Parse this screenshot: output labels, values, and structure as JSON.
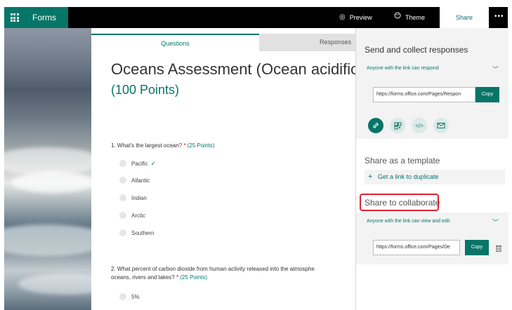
{
  "topbar": {
    "app_name": "Forms",
    "preview_label": "Preview",
    "theme_label": "Theme",
    "share_label": "Share",
    "more_label": "•••"
  },
  "tabs": {
    "questions": "Questions",
    "responses": "Responses"
  },
  "form": {
    "title": "Oceans Assessment (Ocean acidificatio",
    "points": "(100 Points)",
    "questions": [
      {
        "text": "1. What's the largest ocean?",
        "required": "*",
        "points": "(25 Points)",
        "options": [
          "Pacific",
          "Atlantic",
          "Indian",
          "Arctic",
          "Southern"
        ],
        "correct_mark": "✓"
      },
      {
        "text_line1": "2. What percent of carbon dioxide from human activity released into the atmosphe",
        "text_line2": "oceans, rivers and lakes?",
        "required": "*",
        "points": "(25 Points)",
        "options": [
          "5%"
        ]
      }
    ]
  },
  "share_panel": {
    "send_title": "Send and collect responses",
    "respond_permission": "Anyone with the link can respond",
    "respond_link": "https://forms.office.com/Pages/Respon",
    "copy_label": "Copy",
    "share_icons": [
      "link-icon",
      "qr-code-icon",
      "embed-icon",
      "email-icon"
    ],
    "template_title": "Share as a template",
    "duplicate_plus": "+",
    "duplicate_label": "Get a link to duplicate",
    "collab_title": "Share to collaborate",
    "collab_permission": "Anyone with the link can view and edit",
    "collab_link": "https://forms.office.com/Pages/De",
    "collab_copy_label": "Copy"
  },
  "colors": {
    "accent": "#077568",
    "highlight": "#e2202f"
  }
}
